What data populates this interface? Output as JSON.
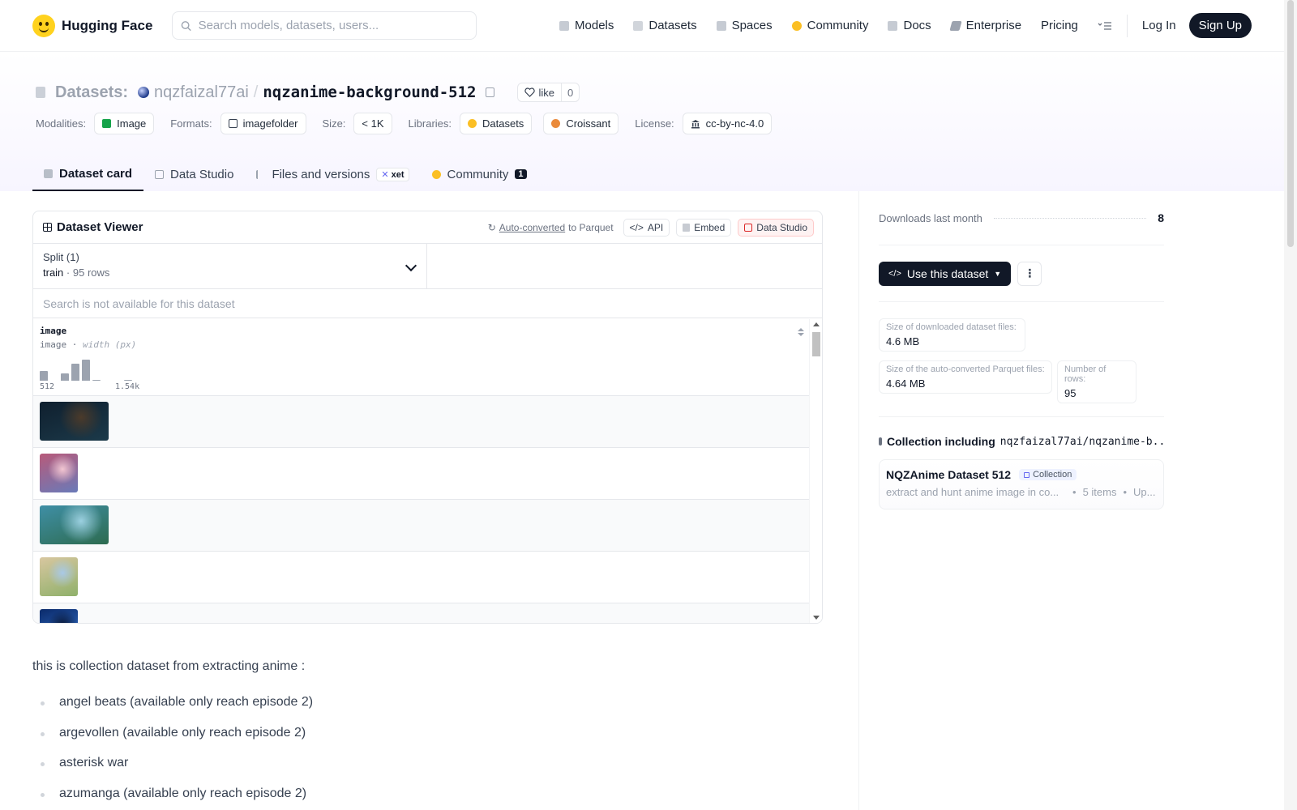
{
  "nav": {
    "brand": "Hugging Face",
    "search_placeholder": "Search models, datasets, users...",
    "links": [
      {
        "label": "Models",
        "color": "#c6cbd3"
      },
      {
        "label": "Datasets",
        "color": "#d1d5db"
      },
      {
        "label": "Spaces",
        "color": "#c6cbd3"
      },
      {
        "label": "Community",
        "color": "#fbbf24"
      },
      {
        "label": "Docs",
        "color": "#c6cbd3"
      },
      {
        "label": "Enterprise",
        "color": "#9ca3af"
      },
      {
        "label": "Pricing"
      }
    ],
    "login": "Log In",
    "signup": "Sign Up"
  },
  "header": {
    "type_label": "Datasets:",
    "owner": "nqzfaizal77ai",
    "slash": "/",
    "name": "nqzanime-background-512",
    "like_label": "like",
    "like_count": "0",
    "meta": {
      "modalities_label": "Modalities:",
      "modality": "Image",
      "formats_label": "Formats:",
      "format": "imagefolder",
      "size_label": "Size:",
      "size": "< 1K",
      "libraries_label": "Libraries:",
      "libraries": [
        "Datasets",
        "Croissant"
      ],
      "license_label": "License:",
      "license": "cc-by-nc-4.0"
    },
    "tabs": [
      {
        "label": "Dataset card",
        "active": true
      },
      {
        "label": "Data Studio"
      },
      {
        "label": "Files and versions",
        "badge": "xet"
      },
      {
        "label": "Community",
        "count": "1"
      }
    ]
  },
  "viewer": {
    "title": "Dataset Viewer",
    "autoconverted_link": "Auto-converted",
    "autoconverted_suffix": "to Parquet",
    "api": "API",
    "embed": "Embed",
    "studio": "Data Studio",
    "split_label": "Split (1)",
    "split_name": "train",
    "split_rows": "95 rows",
    "search_disabled": "Search is not available for this dataset",
    "column": {
      "name": "image",
      "type": "image",
      "stat": "width (px)",
      "hist_min": "512",
      "hist_max": "1.54k",
      "histogram": [
        0.45,
        0.0,
        0.35,
        0.8,
        1.0,
        0.05,
        0.0,
        0.0,
        0.05
      ]
    },
    "rows": [
      {
        "aspect": 1.78,
        "colors": [
          "#0f1f2e",
          "#1c3a4a",
          "#4b3a2a"
        ]
      },
      {
        "aspect": 0.98,
        "colors": [
          "#b85a7a",
          "#6a7ab8",
          "#f2c6d2"
        ]
      },
      {
        "aspect": 1.78,
        "colors": [
          "#3f8fa6",
          "#2d6b4f",
          "#9bd0e0"
        ]
      },
      {
        "aspect": 0.98,
        "colors": [
          "#d8c7a0",
          "#8fb06a",
          "#a9c9e6"
        ]
      },
      {
        "aspect": 0.98,
        "colors": [
          "#0a2a6a",
          "#3a7ad8",
          "#0a1a3a"
        ]
      }
    ]
  },
  "description": {
    "intro": "this is collection dataset from extracting anime :",
    "items": [
      "angel beats (available only reach episode 2)",
      "argevollen (available only reach episode 2)",
      "asterisk war",
      "azumanga (available only reach episode 2)"
    ]
  },
  "sidebar": {
    "downloads_label": "Downloads last month",
    "downloads": "8",
    "use_button": "Use this dataset",
    "more": "⋮",
    "stats": {
      "dl_size_label": "Size of downloaded dataset files:",
      "dl_size": "4.6 MB",
      "parquet_size_label": "Size of the auto-converted Parquet files:",
      "parquet_size": "4.64 MB",
      "rows_label": "Number of rows:",
      "rows": "95"
    },
    "collection": {
      "title_prefix": "Collection including",
      "title_repo": "nqzfaizal77ai/nqzanime-b...",
      "card_name": "NQZAnime Dataset 512",
      "card_badge": "Collection",
      "card_desc": "extract and hunt anime image in co...",
      "card_items": "5 items",
      "card_updated": "Up..."
    }
  }
}
